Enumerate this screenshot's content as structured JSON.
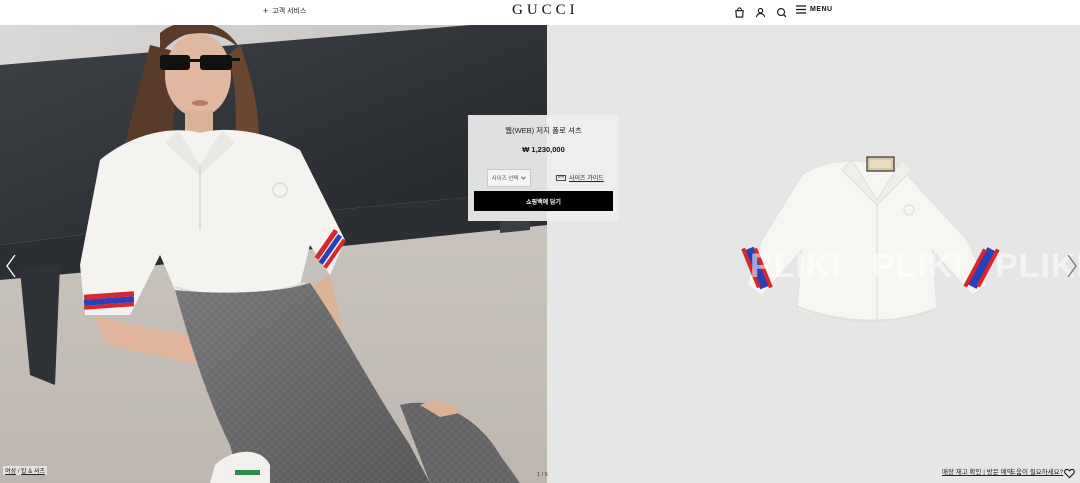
{
  "header": {
    "customer_service": "고객 서비스",
    "logo": "GUCCI",
    "menu_label": "MENU",
    "icons": [
      "shopping-bag-icon",
      "user-icon",
      "search-icon",
      "hamburger-icon"
    ]
  },
  "product": {
    "name": "웹(WEB) 저지 폴로 셔츠",
    "price": "₩ 1,230,000",
    "size_select_label": "사이즈 선택",
    "size_guide_label": "사이즈 가이드",
    "add_to_bag_label": "쇼핑백에 담기"
  },
  "gallery": {
    "counter": "1 / 5",
    "watermark": [
      "PLIKI",
      "PLIKI",
      "PLIKI"
    ]
  },
  "footer": {
    "breadcrumb": [
      "여성",
      "/",
      "탑 & 셔츠"
    ],
    "stock_check": "매장 재고 확인 | 방문 예약",
    "help": "도움이 필요하세요?"
  },
  "colors": {
    "button_bg": "#000000",
    "stripe_red": "#d6262f",
    "stripe_blue": "#2a3fb8"
  }
}
